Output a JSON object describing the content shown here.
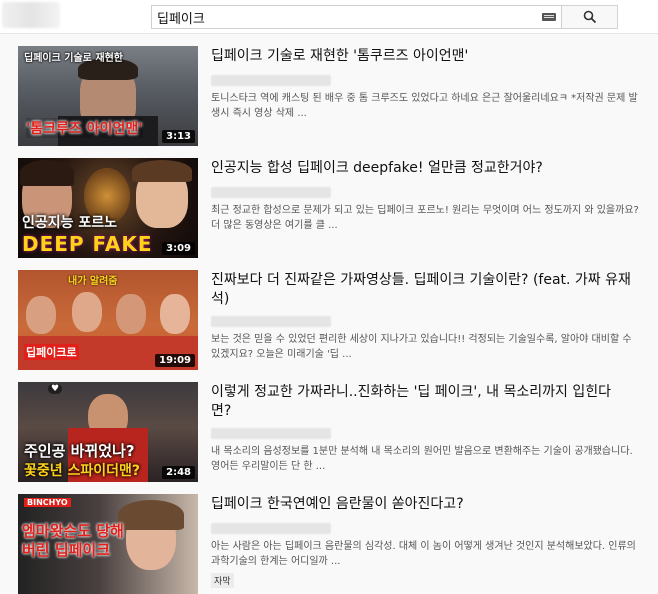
{
  "search": {
    "query": "딥페이크"
  },
  "results": [
    {
      "title": "딥페이크 기술로 재현한 '톰쿠르즈 아이언맨'",
      "description": "토니스타크 역에 캐스팅 된 배우 중 톰 크루즈도 있었다고 하네요 은근 잘어울리네요ㅋ *저작권 문제 발생시 즉시 영상 삭제 ...",
      "duration": "3:13",
      "thumb_top_text": "딥페이크 기술로 재현한",
      "thumb_bottom_text": "'톰크루즈 아이언맨'"
    },
    {
      "title": "인공지능 합성 딥페이크 deepfake! 얼만큼 정교한거야?",
      "description": "최근 정교한 합성으로 문제가 되고 있는 딥페이크 포르노! 원리는 무엇이며 어느 정도까지 와 있을까요? 더 많은 동영상은 여기를 클 ...",
      "duration": "3:09",
      "thumb_top_text": "인공지능 포르노",
      "thumb_bottom_text": "DEEP FAKE"
    },
    {
      "title": "진짜보다 더 진짜같은 가짜영상들. 딥페이크 기술이란? (feat. 가짜 유재석)",
      "description": "보는 것은 믿을 수 있었던 편리한 세상이 지나가고 있습니다!! 걱정되는 기술일수록, 알아야 대비할 수 있겠지요? 오늘은 미래기술 '딥 ...",
      "duration": "19:09",
      "thumb_top_text": "내가 알려줌",
      "thumb_bottom_text": "딥페이크로"
    },
    {
      "title": "이렇게 정교한 가짜라니..진화하는 '딥 페이크', 내 목소리까지 입힌다면?",
      "description": "내 목소리의 음성정보를 1분만 분석해 내 목소리의 원어민 발음으로 변환해주는 기술이 공개됐습니다. 영어든 우리말이든 단 한 ...",
      "duration": "2:48",
      "thumb_top_text": "주인공 바뀌었나?",
      "thumb_bottom_text": "꽃중년 스파이더맨?"
    },
    {
      "title": "딥페이크 한국연예인 음란물이 쏟아진다고?",
      "description": "아는 사람은 아는 딥페이크 음란물의 심각성. 대체 이 놈이 어떻게 생겨난 것인지 분석해보았다. 인류의 과학기술의 한계는 어디일까 ...",
      "badge": "자막",
      "thumb_top_text": "BINCHYO",
      "thumb_bottom_text": "엠마왓슨도 당해버린 딥페이크"
    }
  ],
  "colors": {
    "title": "#111111",
    "description": "#555555",
    "red_accent": "#e0201b",
    "yellow_accent": "#ffd21a"
  }
}
